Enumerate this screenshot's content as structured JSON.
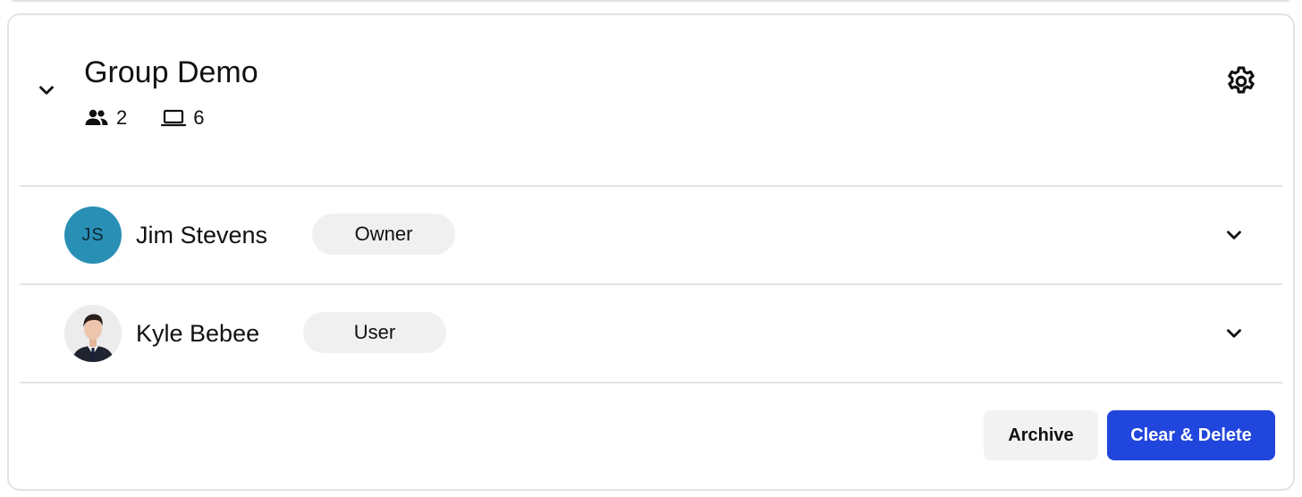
{
  "group": {
    "title": "Group Demo",
    "member_count": "2",
    "device_count": "6",
    "icons": {
      "collapse": "chevron-down-icon",
      "members": "people-icon",
      "devices": "laptop-icon",
      "settings": "gear-icon"
    }
  },
  "members": [
    {
      "name": "Jim Stevens",
      "initials": "JS",
      "role": "Owner",
      "avatar_color": "#2a8fb5"
    },
    {
      "name": "Kyle Bebee",
      "role": "User",
      "avatar": "person-photo"
    }
  ],
  "actions": {
    "archive_label": "Archive",
    "delete_label": "Clear & Delete",
    "delete_color": "#2146dd"
  }
}
